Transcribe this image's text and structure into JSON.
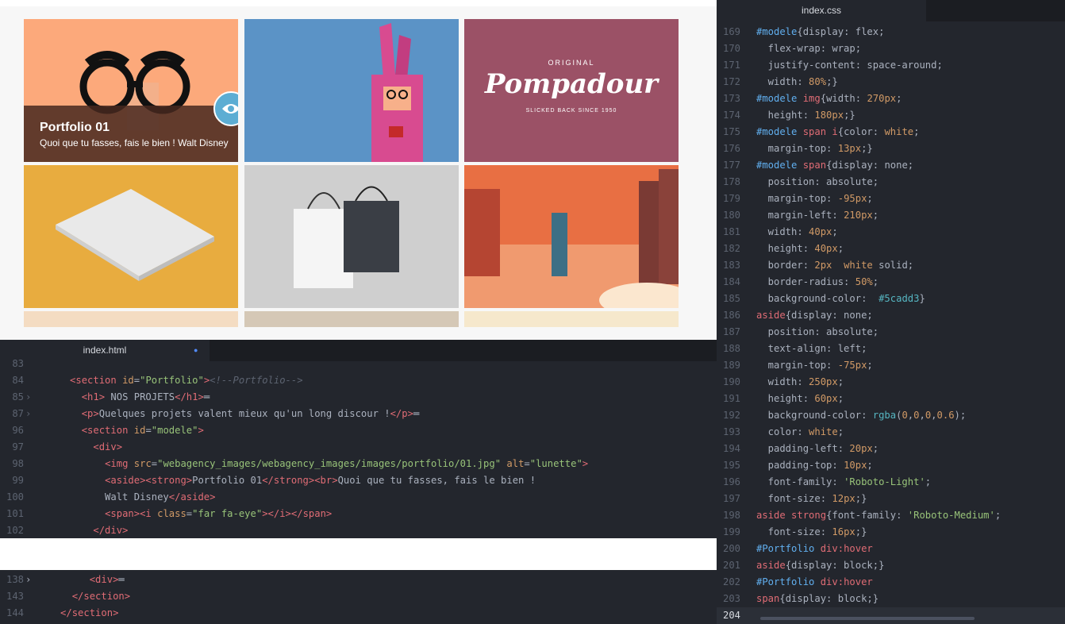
{
  "preview": {
    "portfolio_title": "Portfolio 01",
    "portfolio_subtitle": "Quoi que tu fasses, fais le bien ! Walt Disney",
    "tiles": [
      "lunette",
      "bunny",
      "pompadour",
      "paper",
      "bags",
      "city"
    ],
    "pompadour_logo": {
      "original": "ORIGINAL",
      "brand": "Pompadour",
      "tagline": "SLICKED BACK SINCE 1950"
    },
    "colors": {
      "eye_button": "#5cadd3",
      "tile1": "#fca97b",
      "tile2": "#5b93c6",
      "tile3": "#9b5166",
      "tile4": "#e8ac3f",
      "tile5": "#cfcfcf",
      "tile6": "#e86f43"
    }
  },
  "html_editor": {
    "tab_label": "index.html",
    "modified_dot": "●",
    "lines": [
      {
        "n": "83",
        "fold": "",
        "html": ""
      },
      {
        "n": "84",
        "fold": "",
        "html": "      <span class='tag'>&lt;section</span> <span class='attr'>id</span>=<span class='str'>\"Portfolio\"</span><span class='tag'>&gt;</span><span class='cmt'>&lt;!--Portfolio--&gt;</span>"
      },
      {
        "n": "85",
        "fold": "›",
        "html": "        <span class='tag'>&lt;h1&gt;</span> NOS PROJETS<span class='tag'>&lt;/h1&gt;</span>═"
      },
      {
        "n": "87",
        "fold": "›",
        "html": "        <span class='tag'>&lt;p&gt;</span>Quelques projets valent mieux qu'un long discour !<span class='tag'>&lt;/p&gt;</span>═"
      },
      {
        "n": "96",
        "fold": "",
        "html": "        <span class='tag'>&lt;section</span> <span class='attr'>id</span>=<span class='str'>\"modele\"</span><span class='tag'>&gt;</span>"
      },
      {
        "n": "97",
        "fold": "",
        "html": "          <span class='tag'>&lt;div&gt;</span>"
      },
      {
        "n": "98",
        "fold": "",
        "html": "            <span class='tag'>&lt;img</span> <span class='attr'>src</span>=<span class='str'>\"webagency_images/webagency_images/images/portfolio/01.jpg\"</span> <span class='attr'>alt</span>=<span class='str'>\"lunette\"</span><span class='tag'>&gt;</span>"
      },
      {
        "n": "99",
        "fold": "",
        "html": "            <span class='tag'>&lt;aside&gt;&lt;strong&gt;</span>Portfolio 01<span class='tag'>&lt;/strong&gt;&lt;br&gt;</span>Quoi que tu fasses, fais le bien !"
      },
      {
        "n": "100",
        "fold": "",
        "html": "            Walt Disney<span class='tag'>&lt;/aside&gt;</span>"
      },
      {
        "n": "101",
        "fold": "",
        "html": "            <span class='tag'>&lt;span&gt;&lt;i</span> <span class='attr'>class</span>=<span class='str'>\"far fa-eye\"</span><span class='tag'>&gt;&lt;/i&gt;&lt;/span&gt;</span>"
      },
      {
        "n": "102",
        "fold": "",
        "html": "          <span class='tag'>&lt;/div&gt;</span>"
      }
    ],
    "bottom_lines": [
      {
        "n": "138",
        "fold": "›",
        "html": "          <span class='tag'>&lt;div&gt;</span>═"
      },
      {
        "n": "143",
        "fold": "",
        "html": "        <span class='tag'>&lt;/section&gt;</span>"
      },
      {
        "n": "144",
        "fold": "",
        "html": "      <span class='tag'>&lt;/section&gt;</span>"
      }
    ]
  },
  "css_editor": {
    "tab_label": "index.css",
    "lines": [
      {
        "n": "169",
        "html": "<span class='sel'>#modele</span>{display: flex;"
      },
      {
        "n": "170",
        "html": "  flex-wrap: wrap;"
      },
      {
        "n": "171",
        "html": "  justify-content: space-around;"
      },
      {
        "n": "172",
        "html": "  width: <span class='num'>80%</span>;}"
      },
      {
        "n": "173",
        "html": "<span class='sel'>#modele</span> <span class='tag'>img</span>{width: <span class='num'>270px</span>;"
      },
      {
        "n": "174",
        "html": "  height: <span class='num'>180px</span>;}"
      },
      {
        "n": "175",
        "html": "<span class='sel'>#modele</span> <span class='tag'>span i</span>{color: <span class='num'>white</span>;"
      },
      {
        "n": "176",
        "html": "  margin-top: <span class='num'>13px</span>;}"
      },
      {
        "n": "177",
        "html": "<span class='sel'>#modele</span> <span class='tag'>span</span>{display: none;"
      },
      {
        "n": "178",
        "html": "  position: absolute;"
      },
      {
        "n": "179",
        "html": "  margin-top: <span class='num'>-95px</span>;"
      },
      {
        "n": "180",
        "html": "  margin-left: <span class='num'>210px</span>;"
      },
      {
        "n": "181",
        "html": "  width: <span class='num'>40px</span>;"
      },
      {
        "n": "182",
        "html": "  height: <span class='num'>40px</span>;"
      },
      {
        "n": "183",
        "html": "  border: <span class='num'>2px</span>  <span class='num'>white</span> solid;"
      },
      {
        "n": "184",
        "html": "  border-radius: <span class='num'>50%</span>;"
      },
      {
        "n": "185",
        "html": "  background-color:  <span class='kw'>#5cadd3</span>}"
      },
      {
        "n": "186",
        "html": "<span class='tag'>aside</span>{display: none;"
      },
      {
        "n": "187",
        "html": "  position: absolute;"
      },
      {
        "n": "188",
        "html": "  text-align: left;"
      },
      {
        "n": "189",
        "html": "  margin-top: <span class='num'>-75px</span>;"
      },
      {
        "n": "190",
        "html": "  width: <span class='num'>250px</span>;"
      },
      {
        "n": "191",
        "html": "  height: <span class='num'>60px</span>;"
      },
      {
        "n": "192",
        "html": "  background-color: <span class='kw'>rgba</span>(<span class='num'>0</span>,<span class='num'>0</span>,<span class='num'>0</span>,<span class='num'>0.6</span>);"
      },
      {
        "n": "193",
        "html": "  color: <span class='num'>white</span>;"
      },
      {
        "n": "194",
        "html": "  padding-left: <span class='num'>20px</span>;"
      },
      {
        "n": "195",
        "html": "  padding-top: <span class='num'>10px</span>;"
      },
      {
        "n": "196",
        "html": "  font-family: <span class='str'>'Roboto-Light'</span>;"
      },
      {
        "n": "197",
        "html": "  font-size: <span class='num'>12px</span>;}"
      },
      {
        "n": "198",
        "html": "<span class='tag'>aside strong</span>{font-family: <span class='str'>'Roboto-Medium'</span>;"
      },
      {
        "n": "199",
        "html": "  font-size: <span class='num'>16px</span>;}"
      },
      {
        "n": "200",
        "html": "<span class='sel'>#Portfolio</span> <span class='tag'>div:hover</span>"
      },
      {
        "n": "201",
        "html": "<span class='tag'>aside</span>{display: block;}"
      },
      {
        "n": "202",
        "html": "<span class='sel'>#Portfolio</span> <span class='tag'>div:hover</span>"
      },
      {
        "n": "203",
        "html": "<span class='tag'>span</span>{display: block;}"
      },
      {
        "n": "204",
        "html": ""
      }
    ]
  }
}
